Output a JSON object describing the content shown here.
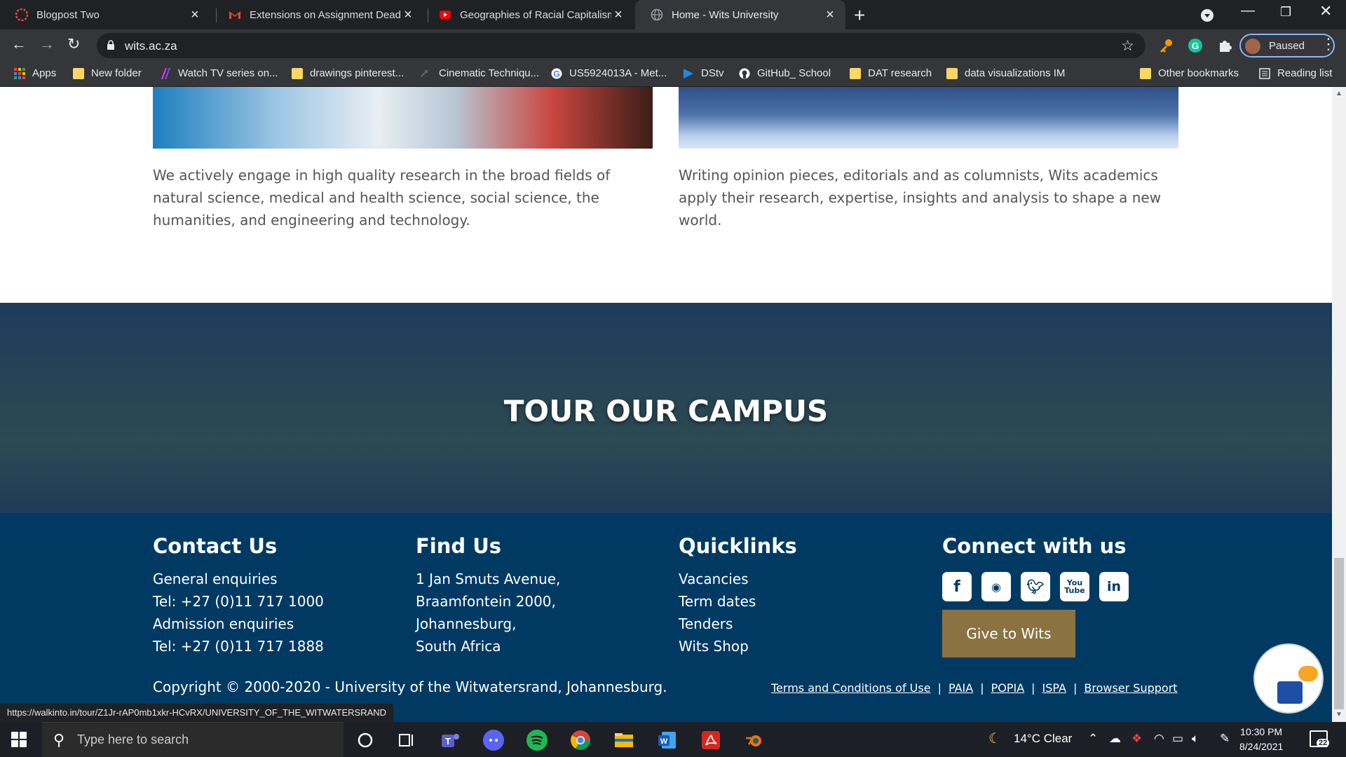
{
  "browser": {
    "tabs": [
      {
        "title": "Blogpost Two",
        "icon": "blogger-icon",
        "color": "#e84c3d"
      },
      {
        "title": "Extensions on Assignment Deadlines",
        "icon": "gmail-icon",
        "color": "#ea4335"
      },
      {
        "title": "Geographies of Racial Capitalism",
        "icon": "youtube-icon",
        "color": "#ff0000"
      },
      {
        "title": "Home - Wits University",
        "icon": "globe-icon",
        "color": "#9aa0a6",
        "active": true
      }
    ],
    "url": "wits.ac.za",
    "profile_label": "Paused",
    "bookmarks": [
      "Apps",
      "New folder",
      "Watch TV series on...",
      "drawings pinterest...",
      "Cinematic Techniqu...",
      "US5924013A - Met...",
      "DStv",
      "GitHub_ School",
      "DAT research",
      "data visualizations IM"
    ],
    "other_bookmarks": "Other bookmarks",
    "reading_list": "Reading list"
  },
  "page": {
    "research_text": "We actively engage in high quality research in the broad fields of natural science, medical and health science, social science, the humanities, and engineering and technology.",
    "opinion_text": "Writing opinion pieces, editorials and as columnists, Wits academics apply their research, expertise, insights and analysis to shape a new world.",
    "tour_title": "TOUR OUR CAMPUS",
    "footer": {
      "contact": {
        "heading": "Contact Us",
        "lines": [
          "General enquiries",
          "Tel: +27 (0)11 717 1000",
          "Admission enquiries",
          "Tel: +27 (0)11 717 1888"
        ]
      },
      "find": {
        "heading": "Find Us",
        "lines": [
          "1 Jan Smuts Avenue,",
          "Braamfontein 2000,",
          "Johannesburg,",
          "South Africa"
        ]
      },
      "quicklinks": {
        "heading": "Quicklinks",
        "lines": [
          "Vacancies",
          "Term dates",
          "Tenders",
          "Wits Shop"
        ]
      },
      "connect": {
        "heading": "Connect with us",
        "social": [
          "f",
          "ig",
          "tw",
          "You\nTube",
          "in"
        ],
        "give_label": "Give to Wits"
      },
      "copyright": "Copyright © 2000-2020 - University of the Witwatersrand, Johannesburg.",
      "legal": [
        "Terms and Conditions of Use",
        "PAIA",
        "POPIA",
        "ISPA",
        "Browser Support"
      ]
    },
    "status_url": "https://walkinto.in/tour/Z1Jr-rAP0mb1xkr-HCvRX/UNIVERSITY_OF_THE_WITWATERSRAND"
  },
  "taskbar": {
    "search_placeholder": "Type here to search",
    "weather": "14°C  Clear",
    "time": "10:30 PM",
    "date": "8/24/2021",
    "notifications": "22"
  }
}
